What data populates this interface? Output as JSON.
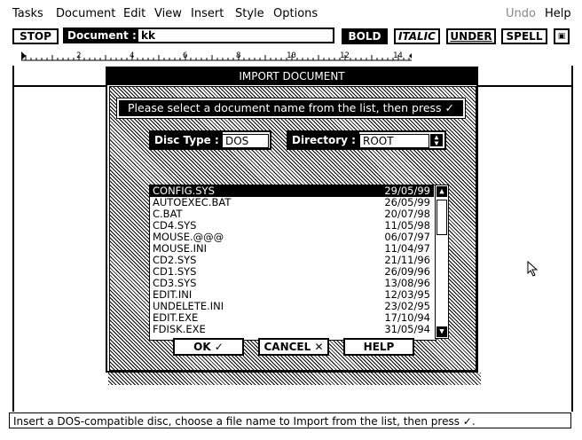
{
  "menu": {
    "items": [
      "Tasks",
      "Document",
      "Edit",
      "View",
      "Insert",
      "Style",
      "Options"
    ],
    "undo": "Undo",
    "help": "Help"
  },
  "toolbar": {
    "stop": "STOP",
    "document_label": "Document :",
    "document_value": "kk",
    "bold": "BOLD",
    "italic": "ITALIC",
    "under": "UNDER",
    "spell": "SPELL"
  },
  "ruler": {
    "marks": [
      "2",
      "4",
      "6",
      "8",
      "10",
      "12",
      "14"
    ]
  },
  "dialog": {
    "title": "IMPORT DOCUMENT",
    "prompt": "Please select a document name from the list, then press ✓",
    "disc_type_label": "Disc Type :",
    "disc_type_value": "DOS",
    "directory_label": "Directory :",
    "directory_value": "ROOT",
    "files": [
      {
        "name": "CONFIG.SYS",
        "date": "29/05/99",
        "selected": true
      },
      {
        "name": "AUTOEXEC.BAT",
        "date": "26/05/99"
      },
      {
        "name": "C.BAT",
        "date": "20/07/98"
      },
      {
        "name": "CD4.SYS",
        "date": "11/05/98"
      },
      {
        "name": "MOUSE.@@@",
        "date": "06/07/97"
      },
      {
        "name": "MOUSE.INI",
        "date": "11/04/97"
      },
      {
        "name": "CD2.SYS",
        "date": "21/11/96"
      },
      {
        "name": "CD1.SYS",
        "date": "26/09/96"
      },
      {
        "name": "CD3.SYS",
        "date": "13/08/96"
      },
      {
        "name": "EDIT.INI",
        "date": "12/03/95"
      },
      {
        "name": "UNDELETE.INI",
        "date": "23/02/95"
      },
      {
        "name": "EDIT.EXE",
        "date": "17/10/94"
      },
      {
        "name": "FDISK.EXE",
        "date": "31/05/94"
      }
    ],
    "ok": "OK ✓",
    "cancel": "CANCEL ✕",
    "help": "HELP"
  },
  "status": "Insert a DOS-compatible disc, choose a file name to Import from the list, then press ✓."
}
